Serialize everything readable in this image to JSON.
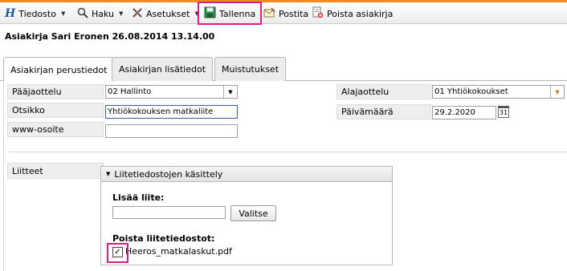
{
  "toolbar": {
    "logo": "H",
    "items": [
      {
        "label": "Tiedosto",
        "icon": "logo-icon"
      },
      {
        "label": "Haku",
        "icon": "search-icon"
      },
      {
        "label": "Asetukset",
        "icon": "settings-icon"
      },
      {
        "label": "Tallenna",
        "icon": "save-icon"
      },
      {
        "label": "Postita",
        "icon": "mail-icon"
      },
      {
        "label": "Poista asiakirja",
        "icon": "delete-document-icon"
      }
    ],
    "caret": "▼",
    "highlight_color": "#d6218a"
  },
  "document": {
    "title": "Asiakirja Sari Eronen 26.08.2014 13.14.00"
  },
  "tabs": [
    "Asiakirjan perustiedot",
    "Asiakirjan lisätiedot",
    "Muistutukset"
  ],
  "form": {
    "main_category_label": "Pääjaottelu",
    "main_category_value": "02 Hallinto",
    "subject_label": "Otsikko",
    "subject_value": "Yhtiökokouksen matkaliite",
    "www_label": "www-osoite",
    "www_value": "",
    "sub_category_label": "Alajaottelu",
    "sub_category_value": "01 Yhtiökokoukset",
    "date_label": "Päivämäärä",
    "date_value": "29.2.2020",
    "calendar_glyph": "31"
  },
  "attachments": {
    "label": "Liitteet",
    "panel_title": "Liitetiedostojen käsittely",
    "panel_toggle": "▼",
    "add_label": "Lisää liite:",
    "file_value": "",
    "choose_button": "Valitse",
    "delete_label": "Poista liitetiedostot:",
    "file_name": "Heeros_matkalaskut.pdf",
    "checked_mark": "✓"
  },
  "colors": {
    "accent": "#f08a24",
    "highlight": "#d6218a",
    "focus_border": "#2f5fb4"
  }
}
